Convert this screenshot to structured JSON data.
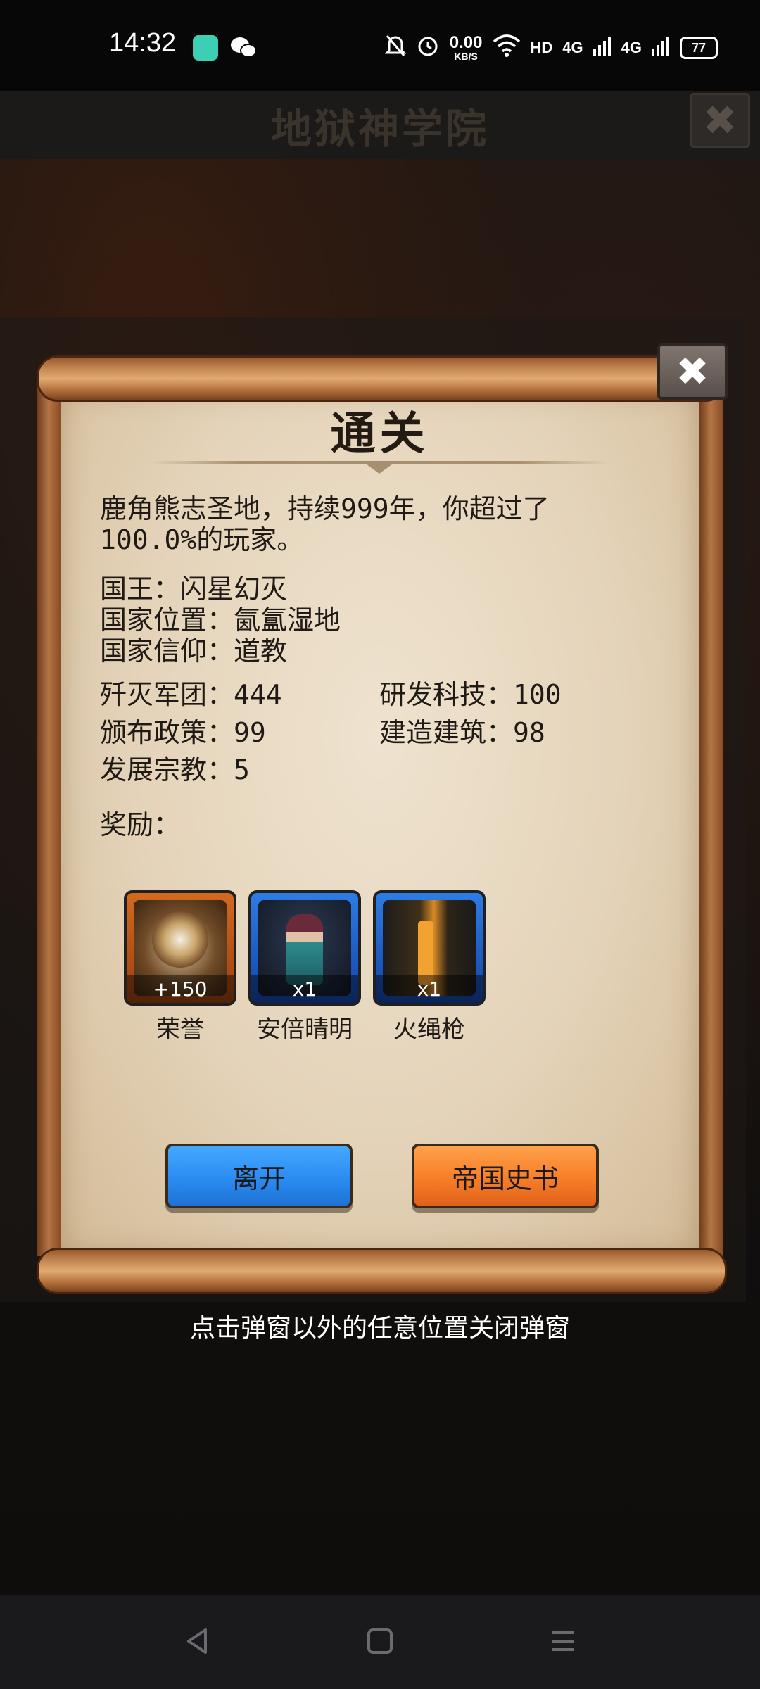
{
  "status_bar": {
    "time": "14:32",
    "speed_value": "0.00",
    "speed_unit": "KB/S",
    "hd": "HD",
    "net1": "4G",
    "net2": "4G",
    "battery": "77",
    "icons": [
      "app-icon",
      "wechat-icon",
      "mute-icon",
      "alarm-icon",
      "wifi-icon",
      "signal-icon"
    ]
  },
  "game": {
    "title": "地狱神学院"
  },
  "dialog": {
    "title": "通关",
    "summary_line1": "鹿角熊志圣地，持续999年，你超过了",
    "summary_line2": "100.0%的玩家。",
    "king": "国王：闪星幻灭",
    "location": "国家位置：氤氲湿地",
    "faith": "国家信仰：道教",
    "stats": {
      "destroyed_legions": "歼灭军团：444",
      "research_tech": "研发科技：100",
      "policies": "颁布政策：99",
      "buildings": "建造建筑：98",
      "religions": "发展宗教：5"
    },
    "rewards_label": "奖励：",
    "rewards": [
      {
        "name": "荣誉",
        "count": "+150",
        "icon": "honor-emblem-icon"
      },
      {
        "name": "安倍晴明",
        "count": "x1",
        "icon": "character-icon"
      },
      {
        "name": "火绳枪",
        "count": "x1",
        "icon": "matchlock-gun-icon"
      }
    ],
    "leave_button": "离开",
    "history_button": "帝国史书"
  },
  "hint": "点击弹窗以外的任意位置关闭弹窗",
  "colors": {
    "leave_button": "#2a8cf2",
    "history_button": "#f77e28",
    "reward_orange": "#d26a1e",
    "reward_blue": "#2d7ce5"
  }
}
